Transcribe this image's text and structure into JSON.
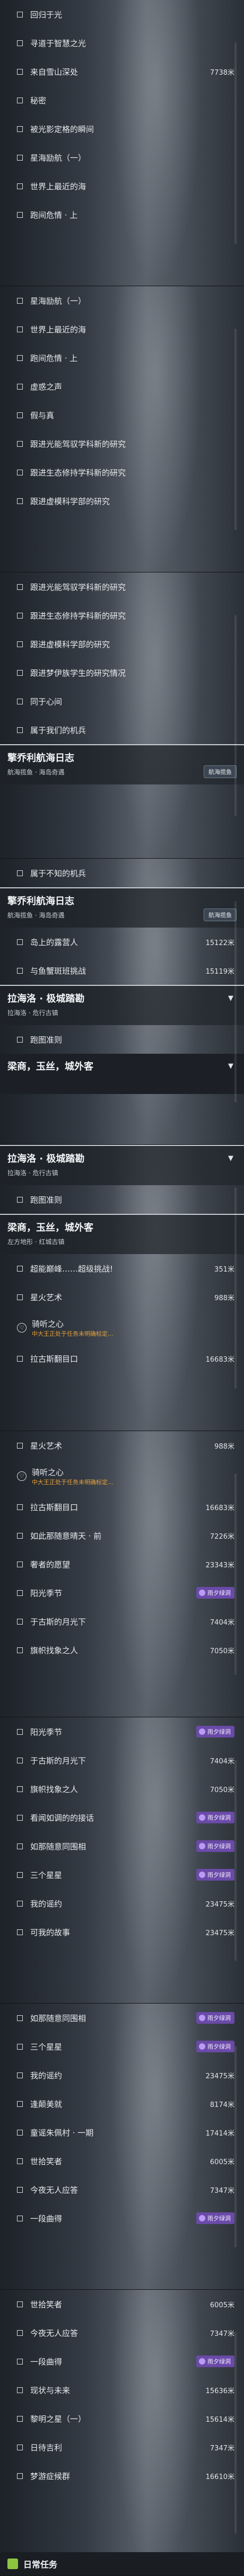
{
  "screens": [
    {
      "rows": [
        {
          "text": "回归于光"
        },
        {
          "text": "寻道于智慧之光"
        },
        {
          "text": "来自雪山深处",
          "dist": "7738米"
        },
        {
          "text": "秘密"
        },
        {
          "text": "被光影定格的瞬间"
        },
        {
          "text": "星海励航（一）"
        },
        {
          "text": "世界上最近的海"
        },
        {
          "text": "跑间危情 · 上"
        }
      ]
    },
    {
      "rows": [
        {
          "text": "星海励航（一）"
        },
        {
          "text": "世界上最近的海"
        },
        {
          "text": "跑间危情 · 上"
        },
        {
          "text": "虚惑之声"
        },
        {
          "text": "假与真"
        },
        {
          "text": "跟进光能驾驭学科新的研究"
        },
        {
          "text": "跟进生态修持学科新的研究"
        },
        {
          "text": "跟进虚模科学部的研究"
        }
      ]
    },
    {
      "rows": [
        {
          "text": "跟进光能驾驭学科新的研究"
        },
        {
          "text": "跟进生态修持学科新的研究"
        },
        {
          "text": "跟进虚模科学部的研究"
        },
        {
          "text": "跟进梦伊族学生的研究情况"
        },
        {
          "text": "同于心间"
        },
        {
          "text": "属于我们的机兵"
        }
      ],
      "header": {
        "title": "擎乔利航海日志",
        "sub": "航海揽鱼 · 海岛奇遇",
        "badge": "航海揽鱼"
      }
    },
    {
      "rows": [
        {
          "text": "属于不知的机兵"
        }
      ],
      "header": {
        "title": "擎乔利航海日志",
        "sub": "航海揽鱼 · 海岛奇遇",
        "badge": "航海揽鱼"
      },
      "rows2": [
        {
          "text": "岛上的露营人",
          "dist": "15122米"
        },
        {
          "text": "与鱼蟹斑班挑战",
          "dist": "15119米"
        }
      ],
      "header2": {
        "title": "拉海洛 · 极城踏勘",
        "sub": "拉海洛 · 危行古镇"
      },
      "rows3": [
        {
          "text": "跑图准则"
        }
      ],
      "header3": {
        "title": "梁商，玉丝，城外客",
        "sub": ""
      }
    },
    {
      "header": {
        "title": "拉海洛 · 极城踏勘",
        "sub": "拉海洛 · 危行古镇"
      },
      "rows": [
        {
          "text": "跑图准则"
        }
      ],
      "header2": {
        "title": "梁商，玉丝，城外客",
        "sub": "左方地形 · 红城古镇"
      },
      "rows2": [
        {
          "text": "超能巅峰……超级挑战!",
          "dist": "351米"
        },
        {
          "text": "星火艺术",
          "dist": "988米"
        },
        {
          "text": "骑听之心",
          "sub": "中大王正处于任务未明确标定…"
        },
        {
          "text": "拉古斯翻目口",
          "dist": "16683米"
        }
      ]
    },
    {
      "rows": [
        {
          "text": "星火艺术",
          "dist": "988米"
        },
        {
          "text": "骑听之心",
          "sub": "中大王正处于任务未明确标定…"
        },
        {
          "text": "拉古斯翻目口",
          "dist": "16683米"
        },
        {
          "text": "如此那随意晴天 · 前",
          "dist": "7226米"
        },
        {
          "text": "奢者的愿望",
          "dist": "23343米"
        },
        {
          "text": "阳光季节",
          "tag": "雨夕绿洞"
        },
        {
          "text": "于古斯的月光下",
          "dist": "7404米"
        },
        {
          "text": "旗帜找象之人",
          "dist": "7050米"
        }
      ]
    },
    {
      "rows": [
        {
          "text": "阳光季节",
          "tag": "雨夕绿洞"
        },
        {
          "text": "于古斯的月光下",
          "dist": "7404米"
        },
        {
          "text": "旗帜找象之人",
          "dist": "7050米"
        },
        {
          "text": "看闻如调的的接话",
          "tag": "雨夕绿洞"
        },
        {
          "text": "如那随意同围相",
          "tag": "雨夕绿洞"
        },
        {
          "text": "三个星星",
          "tag": "雨夕绿洞"
        },
        {
          "text": "我的谣约",
          "dist": "23475米"
        },
        {
          "text": "可我的故事",
          "dist": "23475米"
        }
      ]
    },
    {
      "rows": [
        {
          "text": "如那随意同围相",
          "tag": "雨夕绿洞"
        },
        {
          "text": "三个星星",
          "tag": "雨夕绿洞"
        },
        {
          "text": "我的谣约",
          "dist": "23475米"
        },
        {
          "text": "逢颠美就",
          "dist": "8174米"
        },
        {
          "text": "童谣朱佩村 · 一期",
          "dist": "17414米"
        },
        {
          "text": "世拾笑者",
          "dist": "6005米"
        },
        {
          "text": "今夜无人应答",
          "dist": "7347米"
        },
        {
          "text": "一段曲得",
          "tag": "雨夕绿洞"
        }
      ]
    },
    {
      "rows": [
        {
          "text": "世拾笑者",
          "dist": "6005米"
        },
        {
          "text": "今夜无人应答",
          "dist": "7347米"
        },
        {
          "text": "一段曲得",
          "tag": "雨夕绿洞"
        },
        {
          "text": "现状与未来",
          "dist": "15636米"
        },
        {
          "text": "黎明之星（一）",
          "dist": "15614米"
        },
        {
          "text": "日待吉利",
          "dist": "7347米"
        },
        {
          "text": "梦游症候群",
          "dist": "16610米"
        }
      ],
      "footer": "日常任务"
    }
  ]
}
